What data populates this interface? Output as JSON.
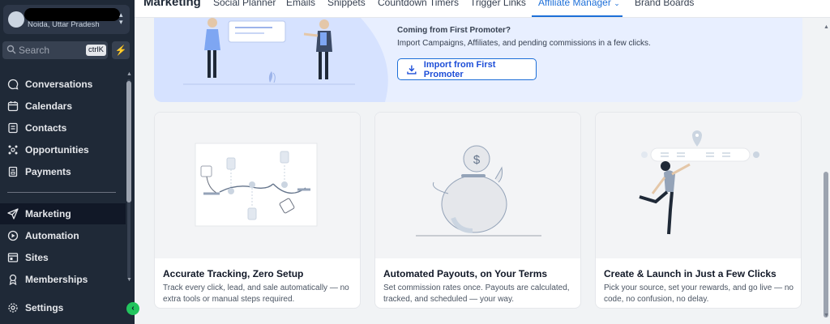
{
  "sidebar": {
    "location": {
      "subtitle": "Noida, Uttar Pradesh"
    },
    "search": {
      "placeholder": "Search",
      "shortcut": "ctrlK"
    },
    "nav": [
      {
        "label": "Conversations",
        "icon": "chat-icon"
      },
      {
        "label": "Calendars",
        "icon": "calendar-icon"
      },
      {
        "label": "Contacts",
        "icon": "contacts-icon"
      },
      {
        "label": "Opportunities",
        "icon": "opportunities-icon"
      },
      {
        "label": "Payments",
        "icon": "payments-icon"
      }
    ],
    "nav2": [
      {
        "label": "Marketing",
        "icon": "send-icon",
        "active": true
      },
      {
        "label": "Automation",
        "icon": "automation-icon"
      },
      {
        "label": "Sites",
        "icon": "sites-icon"
      },
      {
        "label": "Memberships",
        "icon": "memberships-icon"
      }
    ],
    "settings_label": "Settings"
  },
  "header": {
    "title": "Marketing",
    "tabs": [
      {
        "label": "Social Planner"
      },
      {
        "label": "Emails"
      },
      {
        "label": "Snippets"
      },
      {
        "label": "Countdown Timers"
      },
      {
        "label": "Trigger Links"
      },
      {
        "label": "Affiliate Manager",
        "active": true
      },
      {
        "label": "Brand Boards"
      }
    ]
  },
  "banner": {
    "title": "Coming from First Promoter?",
    "description": "Import Campaigns, Affiliates, and pending commissions in a few clicks.",
    "button_label": "Import from First Promoter"
  },
  "cards": [
    {
      "title": "Accurate Tracking, Zero Setup",
      "description": "Track every click, lead, and sale automatically — no extra tools or manual steps required."
    },
    {
      "title": "Automated Payouts, on Your Terms",
      "description": "Set commission rates once. Payouts are calculated, tracked, and scheduled — your way."
    },
    {
      "title": "Create & Launch in Just a Few Clicks",
      "description": "Pick your source, set your rewards, and go live — no code, no confusion, no delay."
    }
  ],
  "colors": {
    "accent": "#1d6fd8",
    "sidebar_bg": "#1f2937",
    "banner_bg": "#e8efff",
    "green": "#22c55e"
  }
}
